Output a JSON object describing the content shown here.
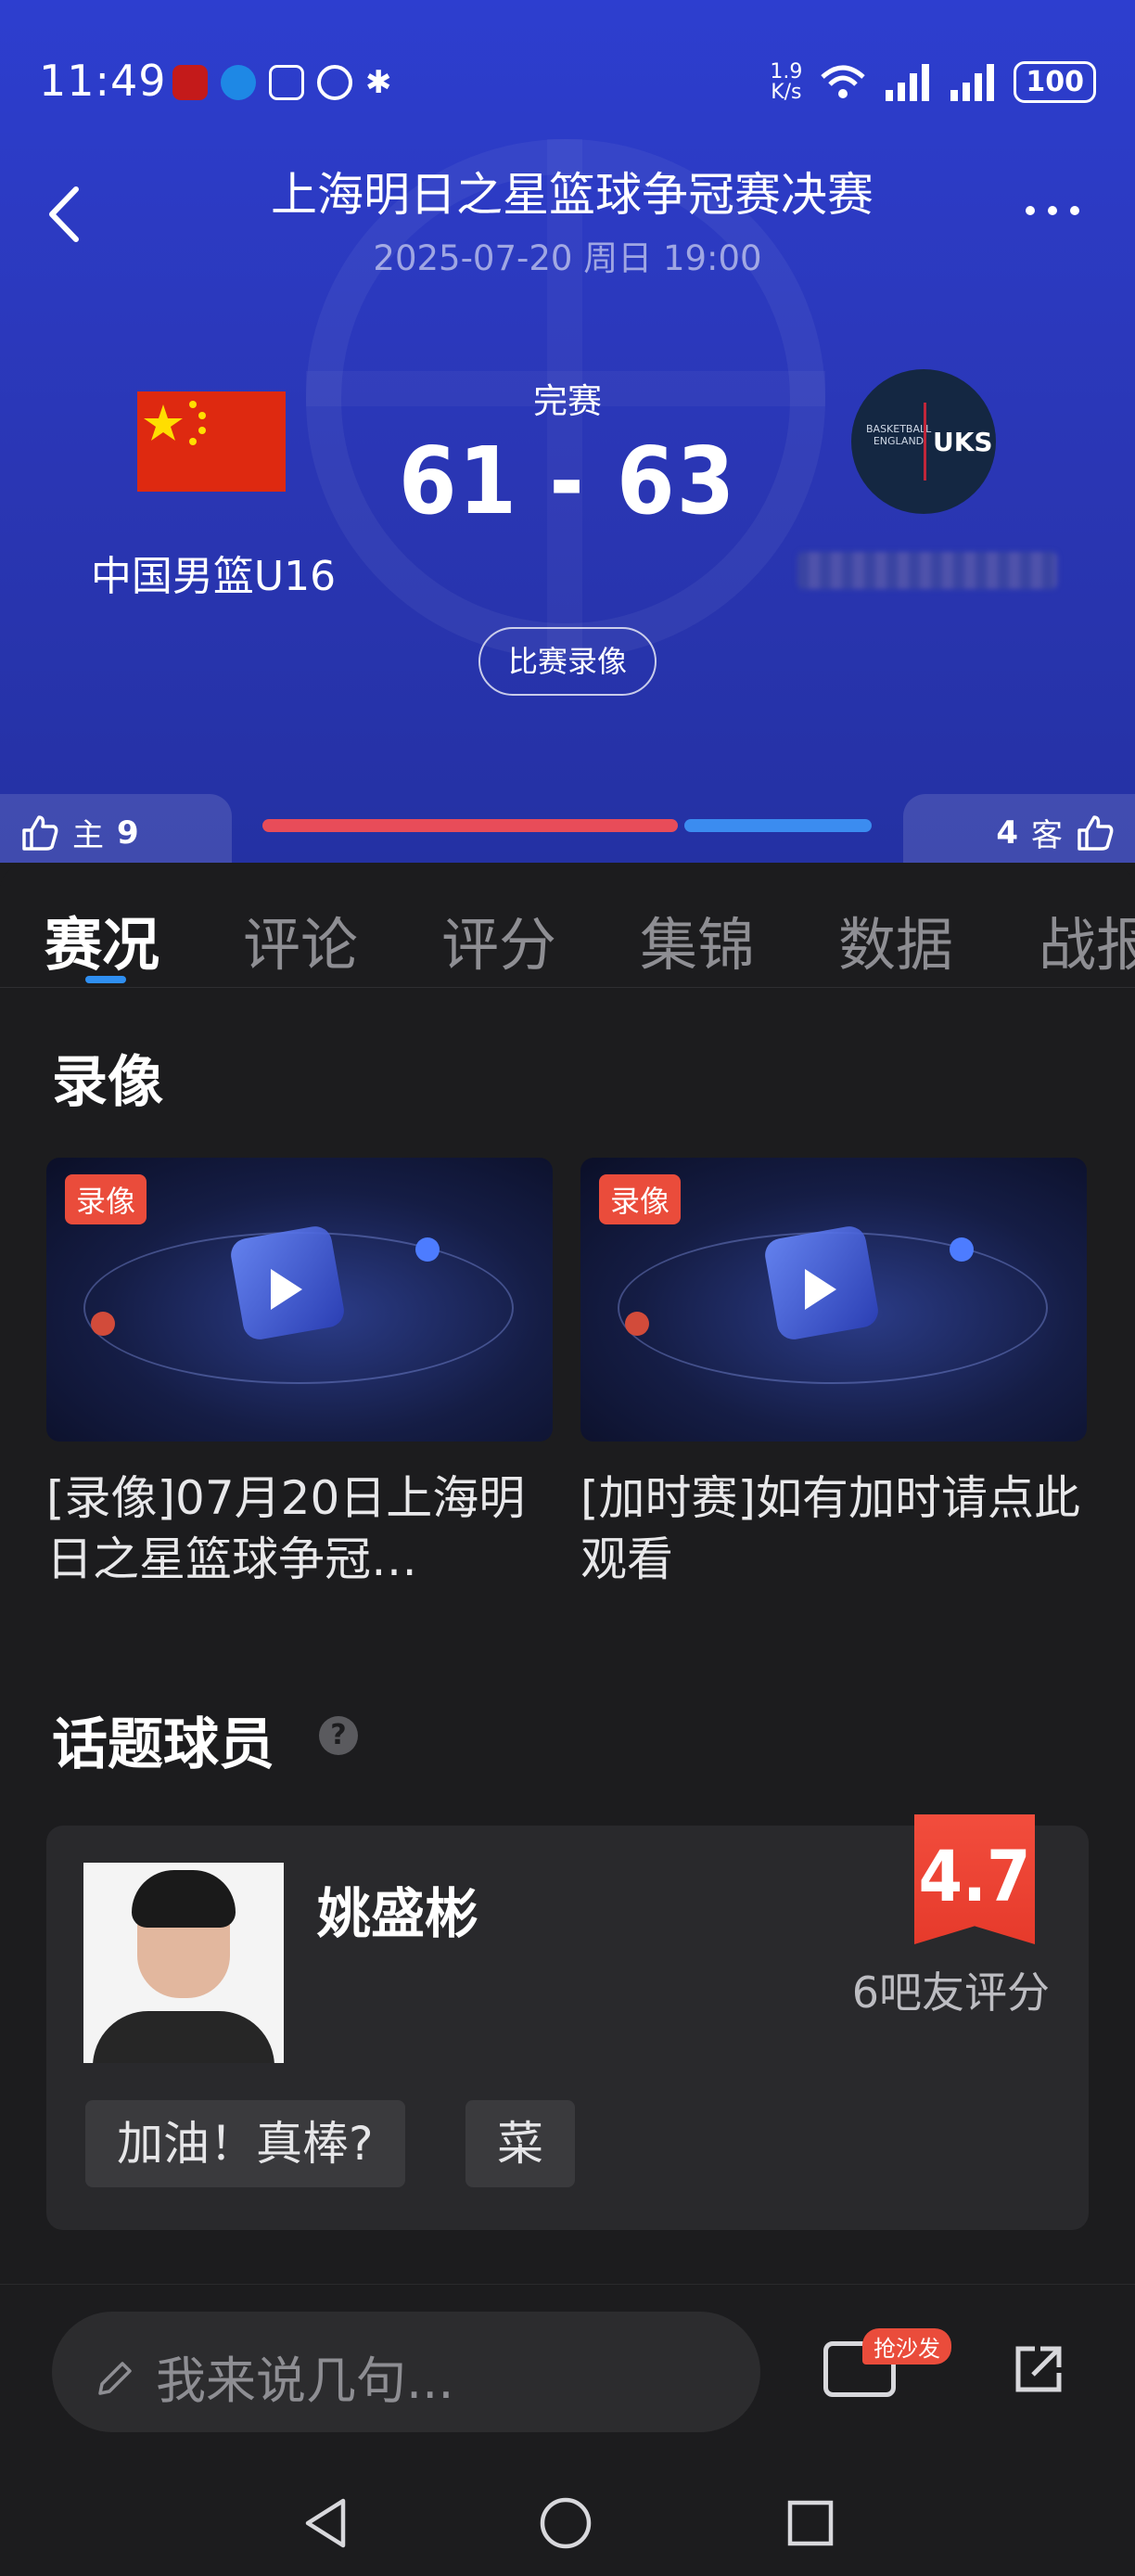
{
  "status_bar": {
    "time": "11:49",
    "net_speed_value": "1.9",
    "net_speed_unit": "K/s",
    "battery": "100"
  },
  "header": {
    "title": "上海明日之星篮球争冠赛决赛",
    "datetime": "2025-07-20 周日 19:00",
    "match_status": "完赛",
    "score": "61 - 63",
    "home_team": "中国男篮U16",
    "away_logo_text": "UKS",
    "away_logo_small": "BASKETBALL ENGLAND",
    "replay_button": "比赛录像",
    "home_votes_label": "主",
    "home_votes": "9",
    "away_votes_label": "客",
    "away_votes": "4",
    "home_vote_share": 0.69
  },
  "tabs": [
    "赛况",
    "评论",
    "评分",
    "集锦",
    "数据",
    "战报"
  ],
  "videos": {
    "section_title": "录像",
    "items": [
      {
        "tag": "录像",
        "title": "[录像]07月20日上海明日之星篮球争冠…"
      },
      {
        "tag": "录像",
        "title": "[加时赛]如有加时请点此观看"
      }
    ]
  },
  "hot_players": {
    "section_title": "话题球员",
    "help_icon": "?",
    "player": {
      "name": "姚盛彬",
      "rating": "4.7",
      "rating_count": "6吧友评分",
      "chips": [
        "加油！真棒?",
        "菜"
      ]
    }
  },
  "bottom": {
    "comment_placeholder": "我来说几句...",
    "sofa_tag": "抢沙发"
  },
  "colors": {
    "header_bg": "#2d3ecf",
    "home_bar": "#e84c59",
    "away_bar": "#3b8cf0",
    "accent": "#2f8ff2",
    "tag_red": "#ea4c3b"
  }
}
